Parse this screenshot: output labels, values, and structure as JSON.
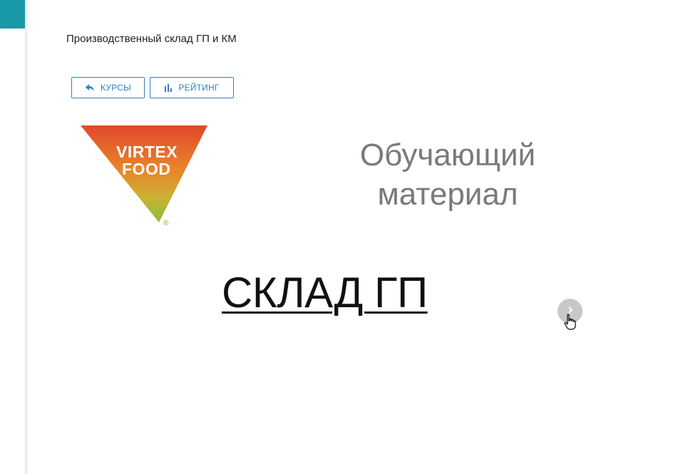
{
  "colors": {
    "accent": "#1a9aa8",
    "button_border": "#2f80c2",
    "subtitle": "#7a7a7a",
    "heading": "#111111"
  },
  "header": {
    "title": "Производственный склад ГП и КМ"
  },
  "toolbar": {
    "courses_label": "КУРСЫ",
    "courses_icon": "reply-arrow-icon",
    "rating_label": "РЕЙТИНГ",
    "rating_icon": "bar-chart-icon"
  },
  "slide": {
    "logo_line1": "VIRTEX",
    "logo_line2": "FOOD",
    "logo_reg": "®",
    "subtitle": "Обучающий материал",
    "heading": "СКЛАД ГП"
  },
  "navigation": {
    "next_icon": "chevron-right-icon"
  }
}
